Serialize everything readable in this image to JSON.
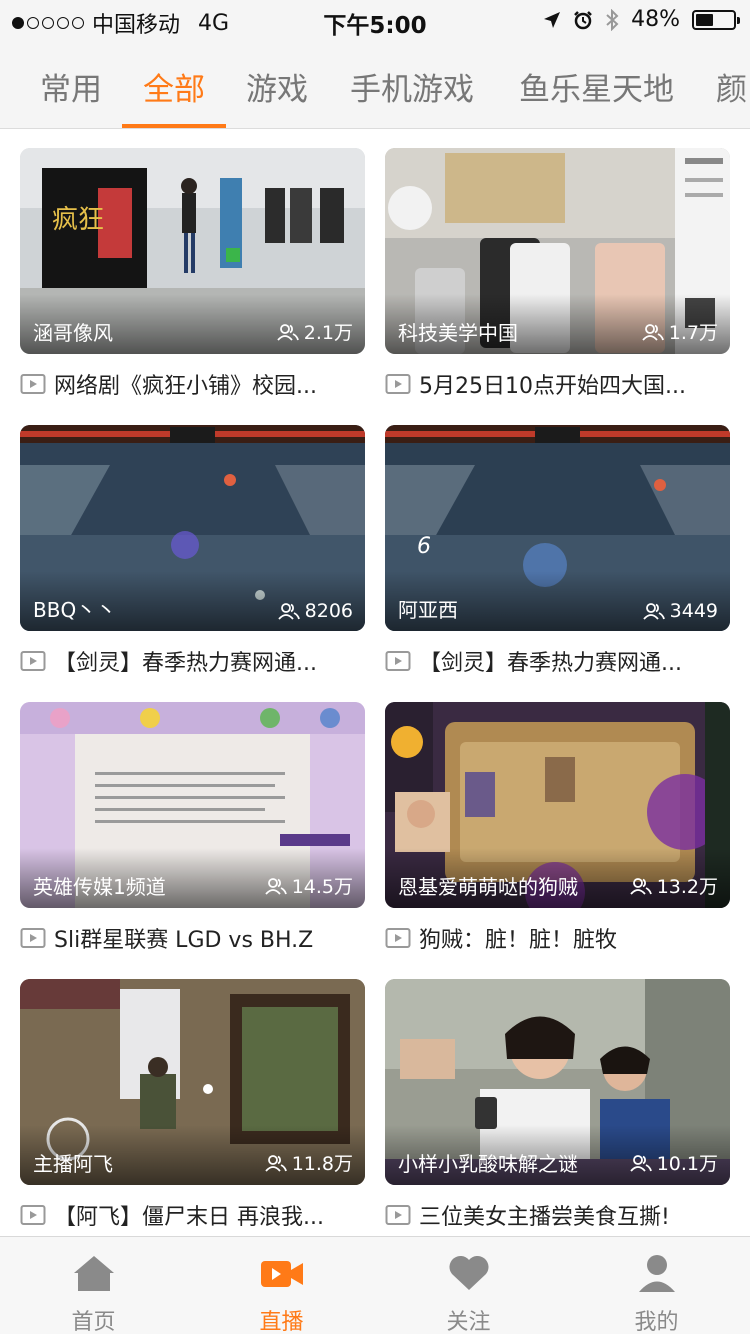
{
  "status_bar": {
    "carrier": "中国移动",
    "network": "4G",
    "time": "下午5:00",
    "battery": "48%",
    "battery_level": 0.48
  },
  "tabs": [
    "常用",
    "全部",
    "游戏",
    "手机游戏",
    "鱼乐星天地",
    "颜"
  ],
  "active_tab": "全部",
  "cards": [
    {
      "anchor": "涵哥像风",
      "viewers": "2.1万",
      "title": "网络剧《疯狂小铺》校园..."
    },
    {
      "anchor": "科技美学中国",
      "viewers": "1.7万",
      "title": "5月25日10点开始四大国..."
    },
    {
      "anchor": "BBQ丶丶",
      "viewers": "8206",
      "title": "【剑灵】春季热力赛网通..."
    },
    {
      "anchor": "阿亚西",
      "viewers": "3449",
      "title": "【剑灵】春季热力赛网通..."
    },
    {
      "anchor": "英雄传媒1频道",
      "viewers": "14.5万",
      "title": "Sli群星联赛 LGD vs BH.Z"
    },
    {
      "anchor": "恩基爱萌萌哒的狗贼",
      "viewers": "13.2万",
      "title": "狗贼：脏！脏！脏牧"
    },
    {
      "anchor": "主播阿飞",
      "viewers": "11.8万",
      "title": "【阿飞】僵尸末日 再浪我..."
    },
    {
      "anchor": "小样小乳酸味解之谜",
      "viewers": "10.1万",
      "title": "三位美女主播尝美食互撕!"
    }
  ],
  "bottom_nav": [
    {
      "label": "首页",
      "icon": "home-icon"
    },
    {
      "label": "直播",
      "icon": "video-camera-icon"
    },
    {
      "label": "关注",
      "icon": "heart-icon"
    },
    {
      "label": "我的",
      "icon": "person-icon"
    }
  ],
  "colors": {
    "accent": "#ff7a17",
    "inactive": "#8a8a8a"
  }
}
